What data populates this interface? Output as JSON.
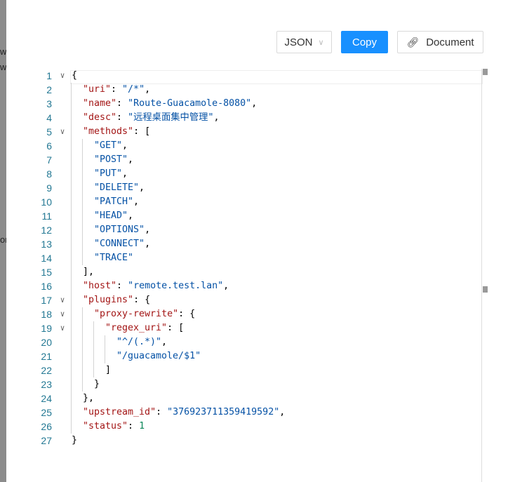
{
  "background_fragments": [
    "w",
    "wa",
    "or"
  ],
  "toolbar": {
    "format_select": "JSON",
    "copy_label": "Copy",
    "document_label": "Document",
    "link_icon": "link-icon"
  },
  "editor": {
    "lines": [
      [
        [
          "p",
          "{"
        ]
      ],
      [
        [
          "k",
          "\"uri\""
        ],
        [
          "p",
          ": "
        ],
        [
          "s",
          "\"/*\""
        ],
        [
          "p",
          ","
        ]
      ],
      [
        [
          "k",
          "\"name\""
        ],
        [
          "p",
          ": "
        ],
        [
          "s",
          "\"Route-Guacamole-8080\""
        ],
        [
          "p",
          ","
        ]
      ],
      [
        [
          "k",
          "\"desc\""
        ],
        [
          "p",
          ": "
        ],
        [
          "s",
          "\"远程桌面集中管理\""
        ],
        [
          "p",
          ","
        ]
      ],
      [
        [
          "k",
          "\"methods\""
        ],
        [
          "p",
          ": ["
        ]
      ],
      [
        [
          "s",
          "\"GET\""
        ],
        [
          "p",
          ","
        ]
      ],
      [
        [
          "s",
          "\"POST\""
        ],
        [
          "p",
          ","
        ]
      ],
      [
        [
          "s",
          "\"PUT\""
        ],
        [
          "p",
          ","
        ]
      ],
      [
        [
          "s",
          "\"DELETE\""
        ],
        [
          "p",
          ","
        ]
      ],
      [
        [
          "s",
          "\"PATCH\""
        ],
        [
          "p",
          ","
        ]
      ],
      [
        [
          "s",
          "\"HEAD\""
        ],
        [
          "p",
          ","
        ]
      ],
      [
        [
          "s",
          "\"OPTIONS\""
        ],
        [
          "p",
          ","
        ]
      ],
      [
        [
          "s",
          "\"CONNECT\""
        ],
        [
          "p",
          ","
        ]
      ],
      [
        [
          "s",
          "\"TRACE\""
        ]
      ],
      [
        [
          "p",
          "],"
        ]
      ],
      [
        [
          "k",
          "\"host\""
        ],
        [
          "p",
          ": "
        ],
        [
          "s",
          "\"remote.test.lan\""
        ],
        [
          "p",
          ","
        ]
      ],
      [
        [
          "k",
          "\"plugins\""
        ],
        [
          "p",
          ": {"
        ]
      ],
      [
        [
          "k",
          "\"proxy-rewrite\""
        ],
        [
          "p",
          ": {"
        ]
      ],
      [
        [
          "k",
          "\"regex_uri\""
        ],
        [
          "p",
          ": ["
        ]
      ],
      [
        [
          "s",
          "\"^/(.*)\""
        ],
        [
          "p",
          ","
        ]
      ],
      [
        [
          "s",
          "\"/guacamole/$1\""
        ]
      ],
      [
        [
          "p",
          "]"
        ]
      ],
      [
        [
          "p",
          "}"
        ]
      ],
      [
        [
          "p",
          "},"
        ]
      ],
      [
        [
          "k",
          "\"upstream_id\""
        ],
        [
          "p",
          ": "
        ],
        [
          "s",
          "\"376923711359419592\""
        ],
        [
          "p",
          ","
        ]
      ],
      [
        [
          "k",
          "\"status\""
        ],
        [
          "p",
          ": "
        ],
        [
          "n",
          "1"
        ]
      ],
      [
        [
          "p",
          "}"
        ]
      ]
    ],
    "indent": [
      0,
      1,
      1,
      1,
      1,
      2,
      2,
      2,
      2,
      2,
      2,
      2,
      2,
      2,
      1,
      1,
      1,
      2,
      3,
      4,
      4,
      3,
      2,
      1,
      1,
      1,
      0
    ],
    "foldable": [
      1,
      5,
      17,
      18,
      19
    ]
  }
}
